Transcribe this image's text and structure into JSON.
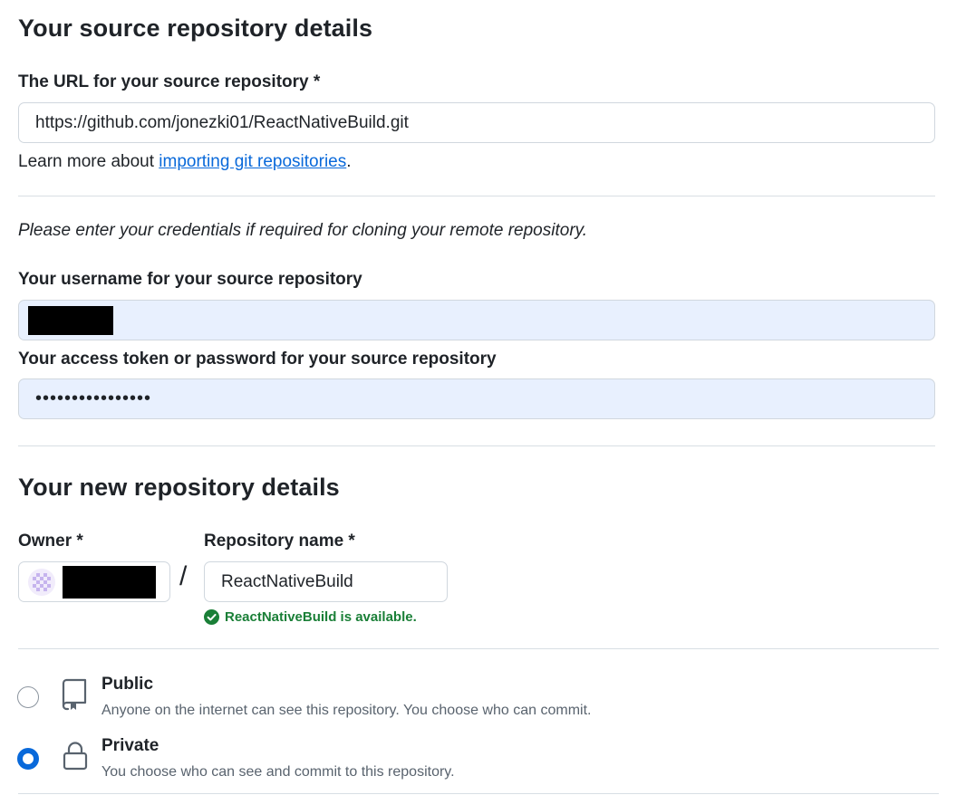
{
  "source": {
    "heading": "Your source repository details",
    "url_label": "The URL for your source repository *",
    "url_value": "https://github.com/jonezki01/ReactNativeBuild.git",
    "learn_prefix": "Learn more about ",
    "learn_link": "importing git repositories",
    "learn_suffix": ".",
    "credentials_note": "Please enter your credentials if required for cloning your remote repository.",
    "username_label": "Your username for your source repository",
    "token_label": "Your access token or password for your source repository",
    "token_mask": "••••••••••••••••"
  },
  "new_repo": {
    "heading": "Your new repository details",
    "owner_label": "Owner *",
    "separator": "/",
    "name_label": "Repository name *",
    "name_value": "ReactNativeBuild",
    "availability": "ReactNativeBuild is available."
  },
  "visibility": {
    "public_title": "Public",
    "public_desc": "Anyone on the internet can see this repository. You choose who can commit.",
    "private_title": "Private",
    "private_desc": "You choose who can see and commit to this repository.",
    "selected": "Private"
  },
  "colors": {
    "accent": "#0969da",
    "success": "#1a7f37",
    "autofill_bg": "#e8f0fe"
  },
  "icons": {
    "owner_avatar": "identicon-avatar",
    "availability": "check-circle-icon",
    "public": "repo-icon",
    "private": "lock-icon"
  }
}
